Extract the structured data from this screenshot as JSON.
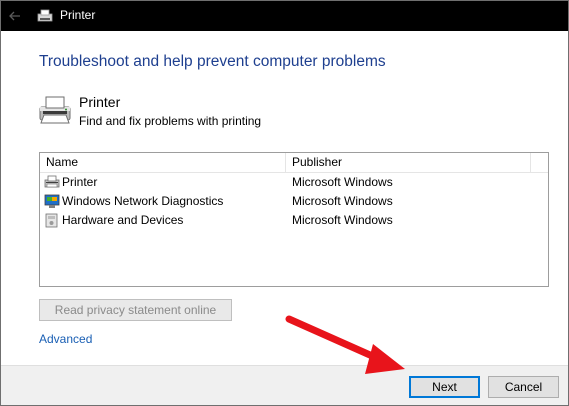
{
  "window": {
    "title": "Printer"
  },
  "main": {
    "heading": "Troubleshoot and help prevent computer problems",
    "item_title": "Printer",
    "item_description": "Find and fix problems with printing"
  },
  "list": {
    "columns": [
      "Name",
      "Publisher"
    ],
    "rows": [
      {
        "name": "Printer",
        "publisher": "Microsoft Windows",
        "icon": "printer-icon"
      },
      {
        "name": "Windows Network Diagnostics",
        "publisher": "Microsoft Windows",
        "icon": "network-diagnostics-icon"
      },
      {
        "name": "Hardware and Devices",
        "publisher": "Microsoft Windows",
        "icon": "hardware-devices-icon"
      }
    ]
  },
  "buttons": {
    "privacy": "Read privacy statement online",
    "advanced": "Advanced",
    "next": "Next",
    "cancel": "Cancel"
  },
  "colors": {
    "heading": "#1e3f8f",
    "link": "#1a5fb4",
    "titlebar": "#000000",
    "annotation_arrow": "#e8141b"
  }
}
